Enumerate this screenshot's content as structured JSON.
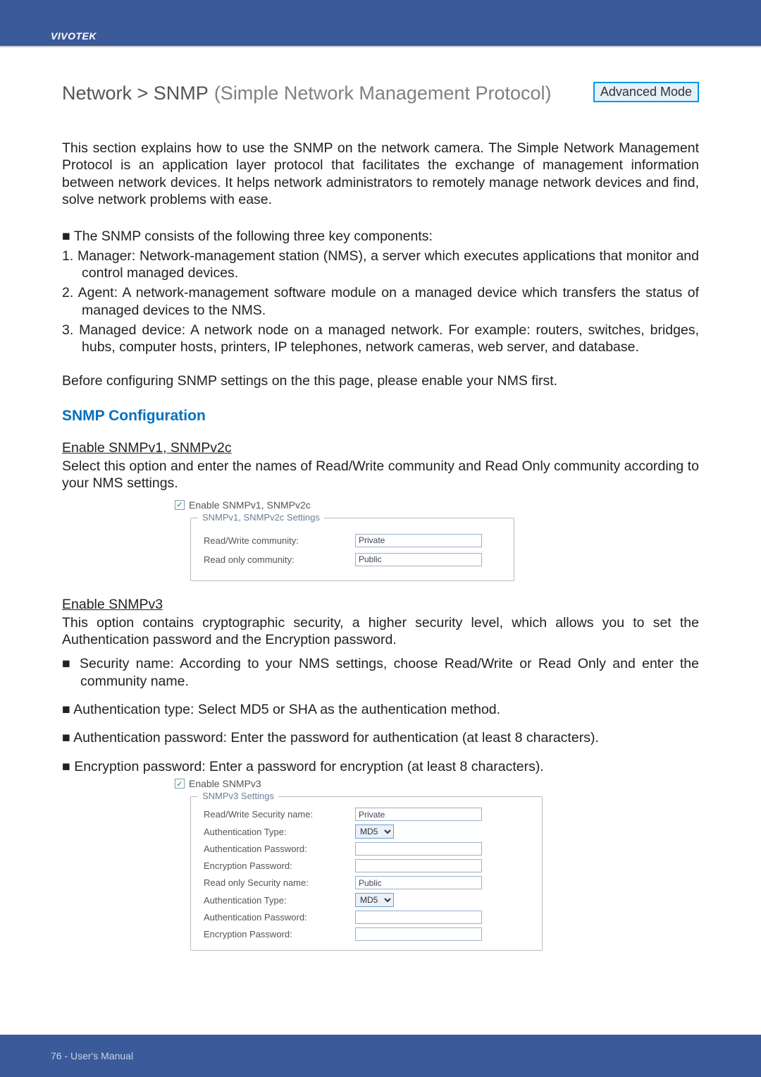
{
  "brand": "VIVOTEK",
  "page": {
    "title_prefix": "Network > SNMP",
    "title_suffix": "(Simple Network Management Protocol)",
    "mode_badge": "Advanced Mode"
  },
  "intro": "This section explains how to use the SNMP on the network camera. The Simple Network Management Protocol is an application layer protocol that facilitates the exchange of management information between network devices. It helps network administrators to remotely manage network devices and find, solve network problems with ease.",
  "components_lead": "■ The SNMP consists of the following three key components:",
  "components": [
    "1. Manager: Network-management station (NMS), a server which executes applications that monitor and control managed devices.",
    "2. Agent: A network-management software module on a managed device which transfers the status of managed devices to the NMS.",
    "3. Managed device: A network node on a managed network. For example: routers, switches, bridges, hubs, computer hosts, printers, IP telephones, network cameras, web server, and database."
  ],
  "before_config": "Before configuring SNMP settings on the this page, please enable your NMS first.",
  "snmp_config_head": "SNMP Configuration",
  "v1v2c": {
    "head": "Enable SNMPv1, SNMPv2c",
    "para": "Select this option and enter the names of Read/Write community and Read Only community according to your NMS settings.",
    "checkbox_label": "Enable SNMPv1, SNMPv2c",
    "fieldset_legend": "SNMPv1, SNMPv2c Settings",
    "rows": {
      "rw_label": "Read/Write community:",
      "rw_value": "Private",
      "ro_label": "Read only community:",
      "ro_value": "Public"
    }
  },
  "v3": {
    "head": "Enable SNMPv3",
    "para": "This option contains cryptographic security, a higher security level, which allows you to set the Authentication password and the Encryption password.",
    "bullets": [
      "■ Security name: According to your NMS settings, choose Read/Write or Read Only and enter the community name.",
      "■ Authentication type: Select MD5 or SHA as the authentication method.",
      "■ Authentication password: Enter the password for authentication (at least 8 characters).",
      "■ Encryption password: Enter a password for encryption (at least 8 characters)."
    ],
    "checkbox_label": "Enable SNMPv3",
    "fieldset_legend": "SNMPv3 Settings",
    "rows": {
      "rw_sec_label": "Read/Write Security name:",
      "rw_sec_value": "Private",
      "auth_type_label": "Authentication Type:",
      "auth_type_value": "MD5",
      "auth_pw_label": "Authentication Password:",
      "auth_pw_value": "",
      "enc_pw_label": "Encryption Password:",
      "enc_pw_value": "",
      "ro_sec_label": "Read only Security name:",
      "ro_sec_value": "Public",
      "auth_type_label2": "Authentication Type:",
      "auth_type_value2": "MD5",
      "auth_pw_label2": "Authentication Password:",
      "auth_pw_value2": "",
      "enc_pw_label2": "Encryption Password:",
      "enc_pw_value2": ""
    }
  },
  "footer": "76 - User's Manual"
}
